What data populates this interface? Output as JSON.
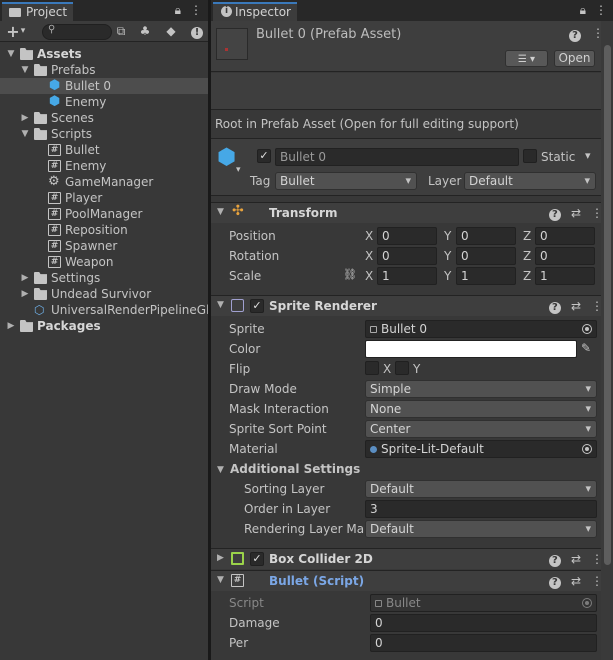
{
  "project": {
    "tab_title": "Project",
    "tree": [
      {
        "label": "Assets",
        "bold": true,
        "depth": 0,
        "arrow": "▼",
        "icon": "folder"
      },
      {
        "label": "Prefabs",
        "depth": 1,
        "arrow": "▼",
        "icon": "folder"
      },
      {
        "label": "Bullet 0",
        "depth": 2,
        "icon": "prefab",
        "selected": true
      },
      {
        "label": "Enemy",
        "depth": 2,
        "icon": "prefab"
      },
      {
        "label": "Scenes",
        "depth": 1,
        "arrow": "▶",
        "icon": "folder"
      },
      {
        "label": "Scripts",
        "depth": 1,
        "arrow": "▼",
        "icon": "folder"
      },
      {
        "label": "Bullet",
        "depth": 2,
        "icon": "script"
      },
      {
        "label": "Enemy",
        "depth": 2,
        "icon": "script"
      },
      {
        "label": "GameManager",
        "depth": 2,
        "icon": "gear"
      },
      {
        "label": "Player",
        "depth": 2,
        "icon": "script"
      },
      {
        "label": "PoolManager",
        "depth": 2,
        "icon": "script"
      },
      {
        "label": "Reposition",
        "depth": 2,
        "icon": "script"
      },
      {
        "label": "Spawner",
        "depth": 2,
        "icon": "script"
      },
      {
        "label": "Weapon",
        "depth": 2,
        "icon": "script"
      },
      {
        "label": "Settings",
        "depth": 1,
        "arrow": "▶",
        "icon": "folder"
      },
      {
        "label": "Undead Survivor",
        "depth": 1,
        "arrow": "▶",
        "icon": "folder"
      },
      {
        "label": "UniversalRenderPipelineGlo",
        "depth": 1,
        "icon": "asset"
      },
      {
        "label": "Packages",
        "bold": true,
        "depth": 0,
        "arrow": "▶",
        "icon": "folder"
      }
    ]
  },
  "inspector": {
    "tab_title": "Inspector",
    "asset_title": "Bullet 0 (Prefab Asset)",
    "open_button": "Open",
    "root_notice": "Root in Prefab Asset (Open for full editing support)",
    "object_name": "Bullet 0",
    "static_label": "Static",
    "tag_label": "Tag",
    "tag_value": "Bullet",
    "layer_label": "Layer",
    "layer_value": "Default",
    "transform": {
      "title": "Transform",
      "rows": [
        {
          "label": "Position",
          "x": "0",
          "y": "0",
          "z": "0"
        },
        {
          "label": "Rotation",
          "x": "0",
          "y": "0",
          "z": "0"
        },
        {
          "label": "Scale",
          "x": "1",
          "y": "1",
          "z": "1"
        }
      ]
    },
    "sprite_renderer": {
      "title": "Sprite Renderer",
      "sprite_label": "Sprite",
      "sprite_value": "Bullet 0",
      "color_label": "Color",
      "color_value": "#ffffff",
      "flip_label": "Flip",
      "flip_x": "X",
      "flip_y": "Y",
      "draw_mode_label": "Draw Mode",
      "draw_mode_value": "Simple",
      "mask_label": "Mask Interaction",
      "mask_value": "None",
      "sort_point_label": "Sprite Sort Point",
      "sort_point_value": "Center",
      "material_label": "Material",
      "material_value": "Sprite-Lit-Default",
      "additional_label": "Additional Settings",
      "sorting_layer_label": "Sorting Layer",
      "sorting_layer_value": "Default",
      "order_label": "Order in Layer",
      "order_value": "3",
      "rendering_label": "Rendering Layer Mas",
      "rendering_value": "Default"
    },
    "box_collider": {
      "title": "Box Collider 2D"
    },
    "bullet_script": {
      "title": "Bullet (Script)",
      "script_label": "Script",
      "script_value": "Bullet",
      "damage_label": "Damage",
      "damage_value": "0",
      "per_label": "Per",
      "per_value": "0"
    }
  },
  "colors": {
    "accent": "#3a79bb",
    "script_title": "#7ba7e6",
    "prefab_icon": "#46a8e6"
  }
}
